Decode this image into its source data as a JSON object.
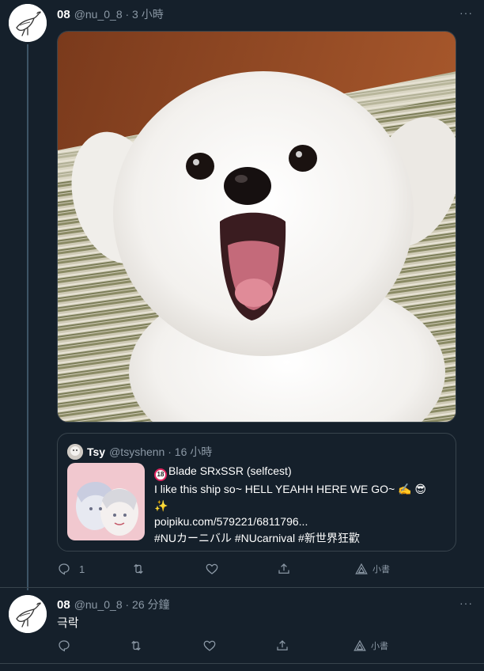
{
  "tweet1": {
    "name": "08",
    "handle": "@nu_0_8 · 3 小時",
    "more": "···",
    "quote": {
      "name": "Tsy",
      "handle": "@tsyshenn · 16 小時",
      "badge": "18",
      "line1": "Blade SRxSSR (selfcest)",
      "line2": "I like this ship so~ HELL YEAHH HERE WE GO~ ✍️ 😎",
      "line3": "✨",
      "line4": "poipiku.com/579221/6811796...",
      "line5": "#NUカーニバル #NUcarnival #新世界狂歡"
    },
    "actions": {
      "reply_count": "1",
      "promote_label": "小書"
    }
  },
  "tweet2": {
    "name": "08",
    "handle": "@nu_0_8 · 26 分鐘",
    "more": "···",
    "text": "극락",
    "actions": {
      "promote_label": "小書"
    }
  },
  "colors": {
    "background": "#15202b",
    "secondary_text": "#8b98a5",
    "border": "#38444d"
  }
}
